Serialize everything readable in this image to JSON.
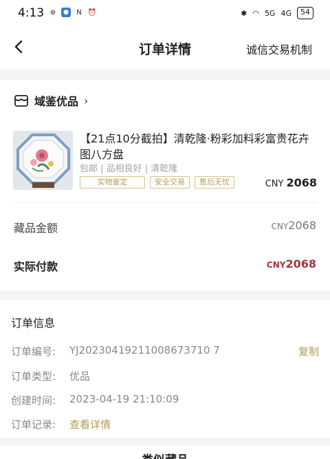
{
  "status": {
    "time": "4:13",
    "battery": "54",
    "signal1": "5G",
    "signal2": "4G"
  },
  "nav": {
    "title": "订单详情",
    "right_action": "诚信交易机制"
  },
  "shop": {
    "name": "域鉴优品"
  },
  "item": {
    "title": "【21点10分截拍】清乾隆·粉彩加料彩富贵花卉图八方盘",
    "meta": "包邮 | 品相良好 | 清乾隆",
    "tags": [
      "实物鉴定",
      "安全交易",
      "售后无忧"
    ],
    "currency": "CNY",
    "price": "2068"
  },
  "amount": {
    "label": "藏品金额",
    "currency": "CNY",
    "value": "2068"
  },
  "paid": {
    "label": "实际付款",
    "currency": "CNY",
    "value": "2068"
  },
  "order_info": {
    "title": "订单信息",
    "number_label": "订单编号:",
    "number_value": "YJ20230419211008673710 7",
    "copy_label": "复制",
    "type_label": "订单类型:",
    "type_value": "优品",
    "created_label": "创建时间:",
    "created_value": "2023-04-19 21:10:09",
    "record_label": "订单记录:",
    "record_link": "查看详情"
  },
  "similar": {
    "title": "类似藏品"
  },
  "colors": {
    "accent_gold": "#b09a5a",
    "price_red": "#a8343a"
  }
}
